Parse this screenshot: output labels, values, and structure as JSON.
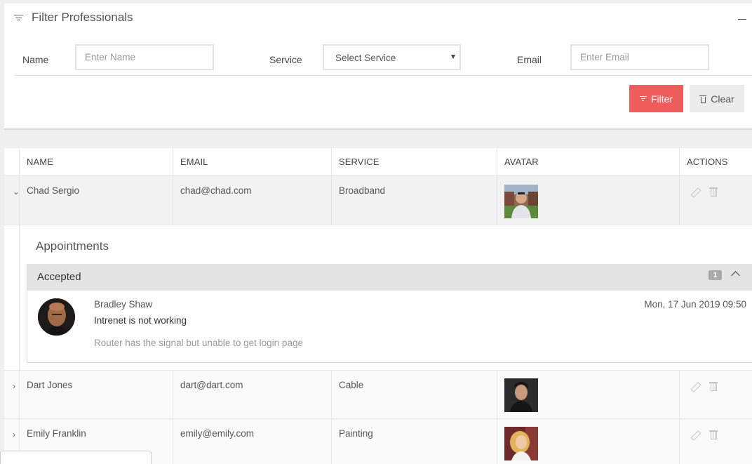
{
  "filter": {
    "title": "Filter Professionals",
    "name_label": "Name",
    "name_placeholder": "Enter Name",
    "service_label": "Service",
    "service_selected": "Select Service",
    "email_label": "Email",
    "email_placeholder": "Enter Email",
    "filter_button": "Filter",
    "clear_button": "Clear"
  },
  "table": {
    "columns": [
      "NAME",
      "EMAIL",
      "SERVICE",
      "AVATAR",
      "ACTIONS"
    ],
    "rows": [
      {
        "name": "Chad Sergio",
        "email": "chad@chad.com",
        "service": "Broadband",
        "expanded": true
      },
      {
        "name": "Dart Jones",
        "email": "dart@dart.com",
        "service": "Cable",
        "expanded": false
      },
      {
        "name": "Emily Franklin",
        "email": "emily@emily.com",
        "service": "Painting",
        "expanded": false
      }
    ]
  },
  "detail": {
    "title": "Appointments",
    "group": "Accepted",
    "count": "1",
    "message": {
      "from": "Bradley Shaw",
      "subject": "Intrenet is not working",
      "body": "Router has the signal but unable to get login page",
      "date": "Mon, 17 Jun 2019 09:50"
    }
  },
  "colors": {
    "accent": "#ee5c5c",
    "expanded_row_bg": "#f2f2f2",
    "accordion_bg": "#e4e4e4"
  }
}
